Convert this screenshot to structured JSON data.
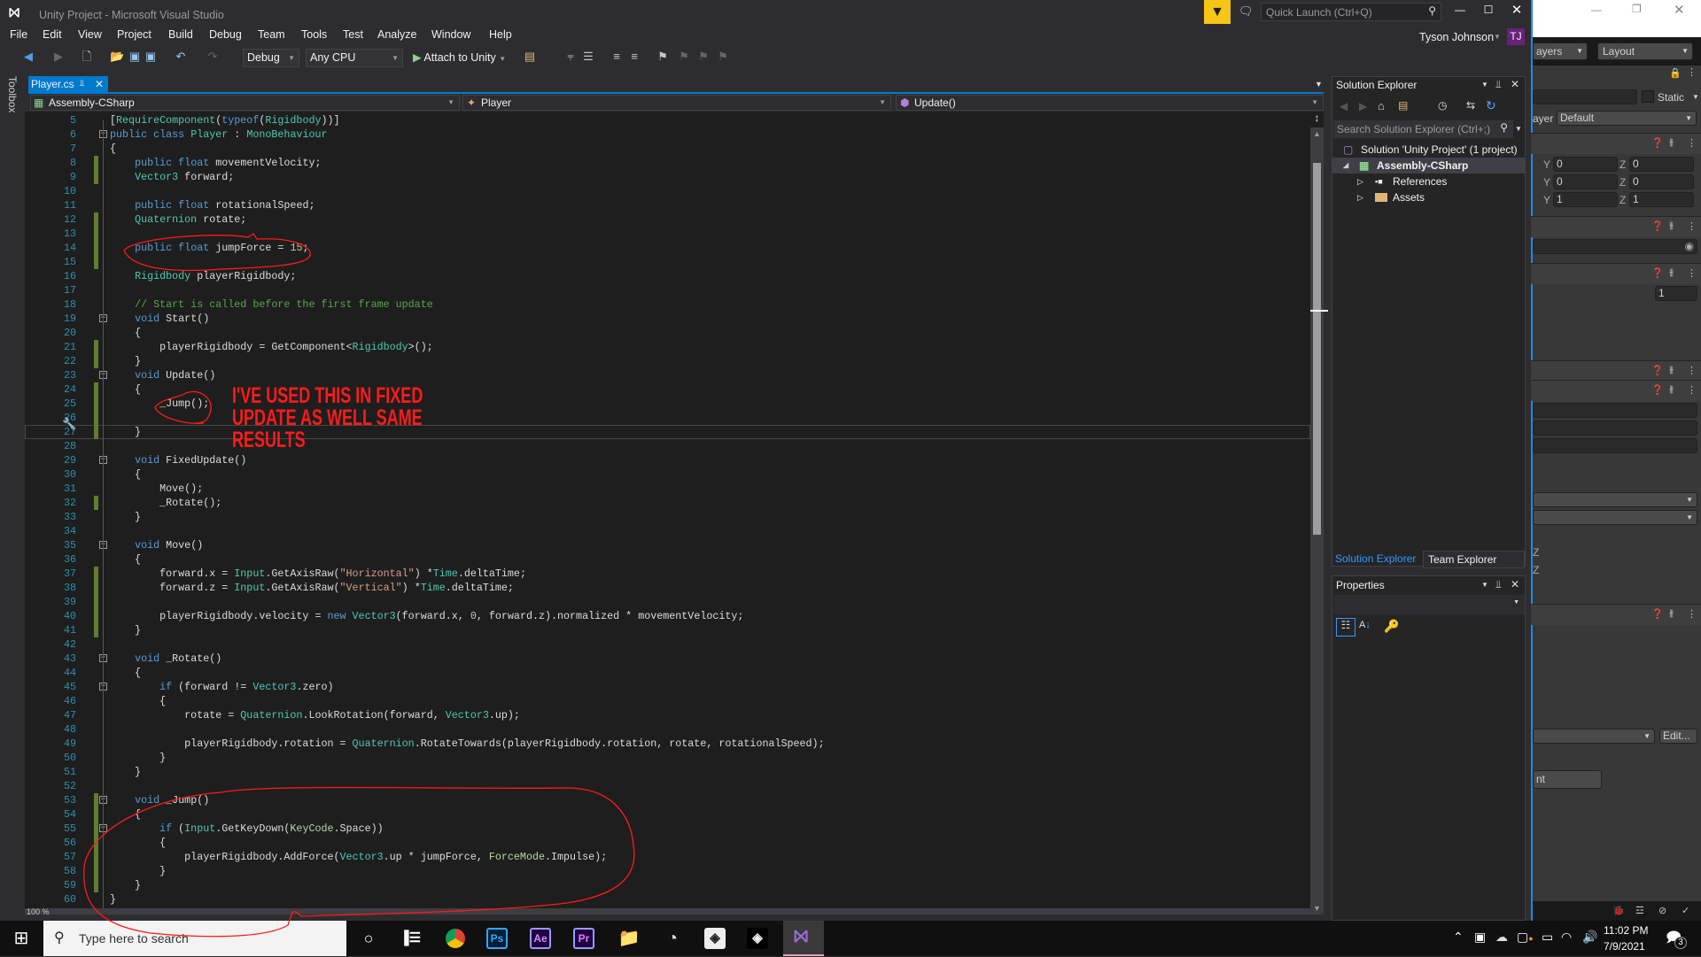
{
  "window": {
    "title": "Unity Project - Microsoft Visual Studio",
    "user_name": "Tyson Johnson",
    "user_initials": "TJ",
    "quick_launch_placeholder": "Quick Launch (Ctrl+Q)"
  },
  "menu": [
    "File",
    "Edit",
    "View",
    "Project",
    "Build",
    "Debug",
    "Team",
    "Tools",
    "Test",
    "Analyze",
    "Window",
    "Help"
  ],
  "toolbar": {
    "config": "Debug",
    "platform": "Any CPU",
    "attach_label": "Attach to Unity"
  },
  "toolbox_label": "Toolbox",
  "tab": {
    "label": "Player.cs"
  },
  "navbar": {
    "project": "Assembly-CSharp",
    "class": "Player",
    "member": "Update()"
  },
  "editor": {
    "zoom": "100 %",
    "changed_lines": [
      8,
      9,
      12,
      13,
      14,
      15,
      21,
      22,
      24,
      25,
      26,
      27,
      32,
      37,
      38,
      39,
      40,
      41,
      53,
      54,
      55,
      56,
      57,
      58,
      59
    ],
    "fold_lines": [
      6,
      19,
      23,
      29,
      35,
      43,
      45,
      53,
      55
    ],
    "current_line": 27,
    "lines": [
      {
        "n": 5,
        "t": [
          [
            "p",
            "["
          ],
          [
            "t",
            "RequireComponent"
          ],
          [
            "p",
            "("
          ],
          [
            "k",
            "typeof"
          ],
          [
            "p",
            "("
          ],
          [
            "t",
            "Rigidbody"
          ],
          [
            "p",
            "))]"
          ]
        ]
      },
      {
        "n": 6,
        "t": [
          [
            "k",
            "public"
          ],
          [
            "p",
            " "
          ],
          [
            "k",
            "class"
          ],
          [
            "p",
            " "
          ],
          [
            "t",
            "Player"
          ],
          [
            "p",
            " : "
          ],
          [
            "t",
            "MonoBehaviour"
          ]
        ]
      },
      {
        "n": 7,
        "t": [
          [
            "p",
            "{"
          ]
        ]
      },
      {
        "n": 8,
        "t": [
          [
            "p",
            "    "
          ],
          [
            "k",
            "public"
          ],
          [
            "p",
            " "
          ],
          [
            "k",
            "float"
          ],
          [
            "p",
            " movementVelocity;"
          ]
        ]
      },
      {
        "n": 9,
        "t": [
          [
            "p",
            "    "
          ],
          [
            "t",
            "Vector3"
          ],
          [
            "p",
            " forward;"
          ]
        ]
      },
      {
        "n": 10,
        "t": []
      },
      {
        "n": 11,
        "t": [
          [
            "p",
            "    "
          ],
          [
            "k",
            "public"
          ],
          [
            "p",
            " "
          ],
          [
            "k",
            "float"
          ],
          [
            "p",
            " rotationalSpeed;"
          ]
        ]
      },
      {
        "n": 12,
        "t": [
          [
            "p",
            "    "
          ],
          [
            "t",
            "Quaternion"
          ],
          [
            "p",
            " rotate;"
          ]
        ]
      },
      {
        "n": 13,
        "t": []
      },
      {
        "n": 14,
        "t": [
          [
            "p",
            "    "
          ],
          [
            "k",
            "public"
          ],
          [
            "p",
            " "
          ],
          [
            "k",
            "float"
          ],
          [
            "p",
            " jumpForce = "
          ],
          [
            "n",
            "15"
          ],
          [
            "p",
            ";"
          ]
        ]
      },
      {
        "n": 15,
        "t": []
      },
      {
        "n": 16,
        "t": [
          [
            "p",
            "    "
          ],
          [
            "t",
            "Rigidbody"
          ],
          [
            "p",
            " playerRigidbody;"
          ]
        ]
      },
      {
        "n": 17,
        "t": []
      },
      {
        "n": 18,
        "t": [
          [
            "p",
            "    "
          ],
          [
            "c",
            "// Start is called before the first frame update"
          ]
        ]
      },
      {
        "n": 19,
        "t": [
          [
            "p",
            "    "
          ],
          [
            "k",
            "void"
          ],
          [
            "p",
            " Start()"
          ]
        ]
      },
      {
        "n": 20,
        "t": [
          [
            "p",
            "    {"
          ]
        ]
      },
      {
        "n": 21,
        "t": [
          [
            "p",
            "        playerRigidbody = GetComponent<"
          ],
          [
            "t",
            "Rigidbody"
          ],
          [
            "p",
            ">();"
          ]
        ]
      },
      {
        "n": 22,
        "t": [
          [
            "p",
            "    }"
          ]
        ]
      },
      {
        "n": 23,
        "t": [
          [
            "p",
            "    "
          ],
          [
            "k",
            "void"
          ],
          [
            "p",
            " Update()"
          ]
        ]
      },
      {
        "n": 24,
        "t": [
          [
            "p",
            "    {"
          ]
        ]
      },
      {
        "n": 25,
        "t": [
          [
            "p",
            "        _Jump();"
          ]
        ]
      },
      {
        "n": 26,
        "t": []
      },
      {
        "n": 27,
        "t": [
          [
            "p",
            "    }"
          ]
        ]
      },
      {
        "n": 28,
        "t": []
      },
      {
        "n": 29,
        "t": [
          [
            "p",
            "    "
          ],
          [
            "k",
            "void"
          ],
          [
            "p",
            " FixedUpdate()"
          ]
        ]
      },
      {
        "n": 30,
        "t": [
          [
            "p",
            "    {"
          ]
        ]
      },
      {
        "n": 31,
        "t": [
          [
            "p",
            "        Move();"
          ]
        ]
      },
      {
        "n": 32,
        "t": [
          [
            "p",
            "        _Rotate();"
          ]
        ]
      },
      {
        "n": 33,
        "t": [
          [
            "p",
            "    }"
          ]
        ]
      },
      {
        "n": 34,
        "t": []
      },
      {
        "n": 35,
        "t": [
          [
            "p",
            "    "
          ],
          [
            "k",
            "void"
          ],
          [
            "p",
            " Move()"
          ]
        ]
      },
      {
        "n": 36,
        "t": [
          [
            "p",
            "    {"
          ]
        ]
      },
      {
        "n": 37,
        "t": [
          [
            "p",
            "        forward.x = "
          ],
          [
            "t",
            "Input"
          ],
          [
            "p",
            ".GetAxisRaw("
          ],
          [
            "s",
            "\"Horizontal\""
          ],
          [
            "p",
            ") *"
          ],
          [
            "t",
            "Time"
          ],
          [
            "p",
            ".deltaTime;"
          ]
        ]
      },
      {
        "n": 38,
        "t": [
          [
            "p",
            "        forward.z = "
          ],
          [
            "t",
            "Input"
          ],
          [
            "p",
            ".GetAxisRaw("
          ],
          [
            "s",
            "\"Vertical\""
          ],
          [
            "p",
            ") *"
          ],
          [
            "t",
            "Time"
          ],
          [
            "p",
            ".deltaTime;"
          ]
        ]
      },
      {
        "n": 39,
        "t": []
      },
      {
        "n": 40,
        "t": [
          [
            "p",
            "        playerRigidbody.velocity = "
          ],
          [
            "k",
            "new"
          ],
          [
            "p",
            " "
          ],
          [
            "t",
            "Vector3"
          ],
          [
            "p",
            "(forward.x, "
          ],
          [
            "n",
            "0"
          ],
          [
            "p",
            ", forward.z).normalized * movementVelocity;"
          ]
        ]
      },
      {
        "n": 41,
        "t": [
          [
            "p",
            "    }"
          ]
        ]
      },
      {
        "n": 42,
        "t": []
      },
      {
        "n": 43,
        "t": [
          [
            "p",
            "    "
          ],
          [
            "k",
            "void"
          ],
          [
            "p",
            " _Rotate()"
          ]
        ]
      },
      {
        "n": 44,
        "t": [
          [
            "p",
            "    {"
          ]
        ]
      },
      {
        "n": 45,
        "t": [
          [
            "p",
            "        "
          ],
          [
            "k",
            "if"
          ],
          [
            "p",
            " (forward != "
          ],
          [
            "t",
            "Vector3"
          ],
          [
            "p",
            ".zero)"
          ]
        ]
      },
      {
        "n": 46,
        "t": [
          [
            "p",
            "        {"
          ]
        ]
      },
      {
        "n": 47,
        "t": [
          [
            "p",
            "            rotate = "
          ],
          [
            "t",
            "Quaternion"
          ],
          [
            "p",
            ".LookRotation(forward, "
          ],
          [
            "t",
            "Vector3"
          ],
          [
            "p",
            ".up);"
          ]
        ]
      },
      {
        "n": 48,
        "t": []
      },
      {
        "n": 49,
        "t": [
          [
            "p",
            "            playerRigidbody.rotation = "
          ],
          [
            "t",
            "Quaternion"
          ],
          [
            "p",
            ".RotateTowards(playerRigidbody.rotation, rotate, rotationalSpeed);"
          ]
        ]
      },
      {
        "n": 50,
        "t": [
          [
            "p",
            "        }"
          ]
        ]
      },
      {
        "n": 51,
        "t": [
          [
            "p",
            "    }"
          ]
        ]
      },
      {
        "n": 52,
        "t": []
      },
      {
        "n": 53,
        "t": [
          [
            "p",
            "    "
          ],
          [
            "k",
            "void"
          ],
          [
            "p",
            " _Jump()"
          ]
        ]
      },
      {
        "n": 54,
        "t": [
          [
            "p",
            "    {"
          ]
        ]
      },
      {
        "n": 55,
        "t": [
          [
            "p",
            "        "
          ],
          [
            "k",
            "if"
          ],
          [
            "p",
            " ("
          ],
          [
            "t",
            "Input"
          ],
          [
            "p",
            ".GetKeyDown("
          ],
          [
            "e",
            "KeyCode"
          ],
          [
            "p",
            ".Space))"
          ]
        ]
      },
      {
        "n": 56,
        "t": [
          [
            "p",
            "        {"
          ]
        ]
      },
      {
        "n": 57,
        "t": [
          [
            "p",
            "            playerRigidbody.AddForce("
          ],
          [
            "t",
            "Vector3"
          ],
          [
            "p",
            ".up * jumpForce, "
          ],
          [
            "e",
            "ForceMode"
          ],
          [
            "p",
            ".Impulse);"
          ]
        ]
      },
      {
        "n": 58,
        "t": [
          [
            "p",
            "        }"
          ]
        ]
      },
      {
        "n": 59,
        "t": [
          [
            "p",
            "    }"
          ]
        ]
      },
      {
        "n": 60,
        "t": [
          [
            "p",
            "}"
          ]
        ]
      },
      {
        "n": 61,
        "t": []
      }
    ]
  },
  "annotation": {
    "lines": [
      "I'VE USED THIS IN FIXED",
      "UPDATE AS WELL SAME",
      "RESULTS"
    ],
    "color": "#ff1a1a"
  },
  "solution_explorer": {
    "title": "Solution Explorer",
    "search_placeholder": "Search Solution Explorer (Ctrl+;)",
    "tree": [
      {
        "label": "Solution 'Unity Project' (1 project)",
        "icon": "solution-icon",
        "level": 0
      },
      {
        "label": "Assembly-CSharp",
        "icon": "csharp-project-icon",
        "level": 1,
        "selected": true,
        "expanded": true
      },
      {
        "label": "References",
        "icon": "references-icon",
        "level": 2
      },
      {
        "label": "Assets",
        "icon": "folder-icon",
        "level": 2
      }
    ],
    "tabs": [
      "Solution Explorer",
      "Team Explorer"
    ],
    "active_tab": "Solution Explorer"
  },
  "properties": {
    "title": "Properties"
  },
  "unity": {
    "layers_label": "ayers",
    "layout_label": "Layout",
    "static_label": "Static",
    "layer_label": "ayer",
    "layer_value": "Default",
    "transform": [
      {
        "y": "0",
        "z": "0"
      },
      {
        "y": "0",
        "z": "0"
      },
      {
        "y": "1",
        "z": "1"
      }
    ],
    "field_value": "1",
    "z_labels": [
      "Z",
      "Z"
    ],
    "edit_button": "Edit...",
    "partial_button": "nt"
  },
  "taskbar": {
    "search_placeholder": "Type here to search",
    "apps": [
      "cortana",
      "task-view",
      "chrome",
      "photoshop",
      "after-effects",
      "premiere",
      "file-explorer",
      "obs",
      "unity",
      "unity-hub",
      "visual-studio"
    ],
    "time": "11:02 PM",
    "date": "7/9/2021",
    "notification_count": "3"
  },
  "colors": {
    "accent": "#007acc",
    "vs_purple": "#68217a",
    "editor_bg": "#1e1e1e",
    "annotation": "#ff1a1a"
  }
}
